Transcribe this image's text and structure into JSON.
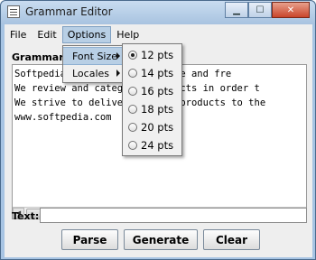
{
  "window": {
    "title": "Grammar Editor"
  },
  "menubar": {
    "items": [
      "File",
      "Edit",
      "Options",
      "Help"
    ]
  },
  "options_menu": {
    "items": [
      {
        "label": "Font Size"
      },
      {
        "label": "Locales"
      }
    ]
  },
  "font_size_menu": {
    "items": [
      "12 pts",
      "14 pts",
      "16 pts",
      "18 pts",
      "20 pts",
      "24 pts"
    ],
    "selected": "12 pts"
  },
  "editor": {
    "label": "Grammar:",
    "lines": [
      "Softpedia ... over 70,000 free and fre",
      "We review and categ ... products in order t",
      "We strive to delive ... best products to the",
      "",
      "www.softpedia.com"
    ]
  },
  "text_field": {
    "label": "Text:",
    "value": ""
  },
  "buttons": {
    "parse": "Parse",
    "generate": "Generate",
    "clear": "Clear"
  }
}
